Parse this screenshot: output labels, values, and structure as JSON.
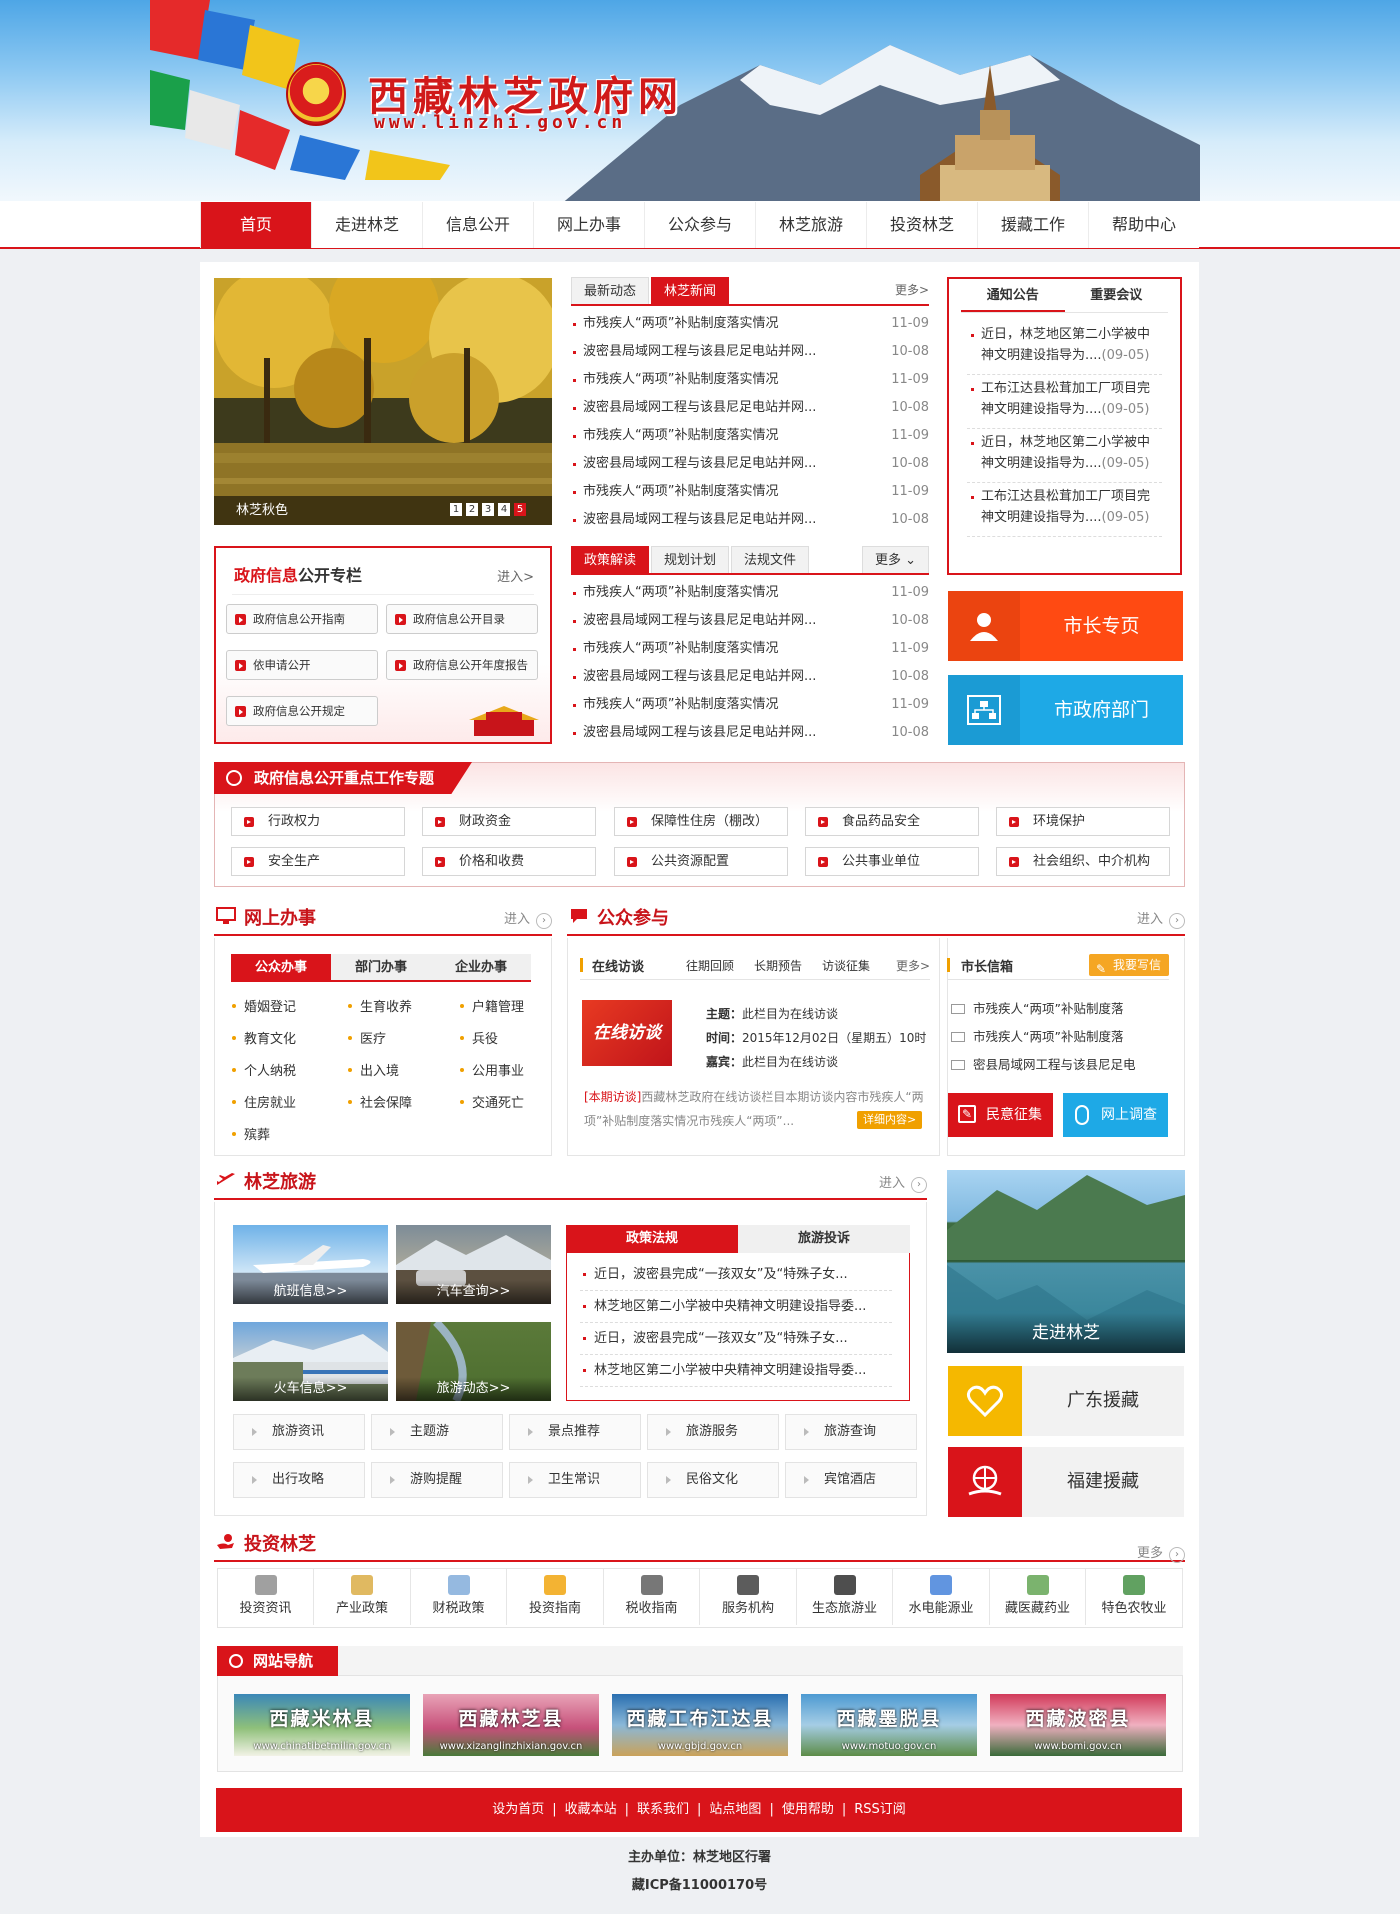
{
  "header": {
    "site_title": "西藏林芝政府网",
    "site_url": "www.linzhi.gov.cn"
  },
  "nav": [
    "首页",
    "走进林芝",
    "信息公开",
    "网上办事",
    "公众参与",
    "林芝旅游",
    "投资林芝",
    "援藏工作",
    "帮助中心"
  ],
  "slideshow": {
    "caption": "林芝秋色",
    "pages": [
      "1",
      "2",
      "3",
      "4",
      "5"
    ],
    "active_page": "5"
  },
  "news1": {
    "tabs": [
      "最新动态",
      "林芝新闻"
    ],
    "active": "林芝新闻",
    "more": "更多>",
    "items": [
      {
        "title": "市残疾人“两项”补贴制度落实情况",
        "date": "11-09"
      },
      {
        "title": "波密县局域网工程与该县尼足电站并网...",
        "date": "10-08"
      },
      {
        "title": "市残疾人“两项”补贴制度落实情况",
        "date": "11-09"
      },
      {
        "title": "波密县局域网工程与该县尼足电站并网...",
        "date": "10-08"
      },
      {
        "title": "市残疾人“两项”补贴制度落实情况",
        "date": "11-09"
      },
      {
        "title": "波密县局域网工程与该县尼足电站并网...",
        "date": "10-08"
      },
      {
        "title": "市残疾人“两项”补贴制度落实情况",
        "date": "11-09"
      },
      {
        "title": "波密县局域网工程与该县尼足电站并网...",
        "date": "10-08"
      }
    ]
  },
  "news2": {
    "tabs": [
      "政策解读",
      "规划计划",
      "法规文件"
    ],
    "active": "政策解读",
    "more": "更多",
    "items": [
      {
        "title": "市残疾人“两项”补贴制度落实情况",
        "date": "11-09"
      },
      {
        "title": "波密县局域网工程与该县尼足电站并网...",
        "date": "10-08"
      },
      {
        "title": "市残疾人“两项”补贴制度落实情况",
        "date": "11-09"
      },
      {
        "title": "波密县局域网工程与该县尼足电站并网...",
        "date": "10-08"
      },
      {
        "title": "市残疾人“两项”补贴制度落实情况",
        "date": "11-09"
      },
      {
        "title": "波密县局域网工程与该县尼足电站并网...",
        "date": "10-08"
      }
    ]
  },
  "notice": {
    "tabs": [
      "通知公告",
      "重要会议"
    ],
    "items": [
      {
        "title": "近日，林芝地区第二小学被中神文明建设指导为....",
        "date": "(09-05)"
      },
      {
        "title": "工布江达县松茸加工厂项目完神文明建设指导为....",
        "date": "(09-05)"
      },
      {
        "title": "近日，林芝地区第二小学被中神文明建设指导为....",
        "date": "(09-05)"
      },
      {
        "title": "工布江达县松茸加工厂项目完神文明建设指导为....",
        "date": "(09-05)"
      }
    ]
  },
  "bigbuttons": {
    "mayor": "市长专页",
    "depts": "市政府部门",
    "mayor_color": "#ff4a12",
    "depts_color": "#1ea9e6"
  },
  "govinfo": {
    "title_red": "政府信息",
    "title_black": "公开专栏",
    "enter": "进入>",
    "buttons": [
      "政府信息公开指南",
      "政府信息公开目录",
      "依申请公开",
      "政府信息公开年度报告",
      "政府信息公开规定"
    ]
  },
  "topics": {
    "title": "政府信息公开重点工作专题",
    "items": [
      "行政权力",
      "财政资金",
      "保障性住房（棚改）",
      "食品药品安全",
      "环境保护",
      "安全生产",
      "价格和收费",
      "公共资源配置",
      "公共事业单位",
      "社会组织、中介机构"
    ]
  },
  "online": {
    "title": "网上办事",
    "enter": "进入",
    "tabs": [
      "公众办事",
      "部门办事",
      "企业办事"
    ],
    "items": [
      "婚姻登记",
      "生育收养",
      "户籍管理",
      "教育文化",
      "医疗",
      "兵役",
      "个人纳税",
      "出入境",
      "公用事业",
      "住房就业",
      "社会保障",
      "交通死亡",
      "殡葬"
    ]
  },
  "public": {
    "title": "公众参与",
    "enter": "进入",
    "interview": {
      "title": "在线访谈",
      "tabs": [
        "往期回顾",
        "长期预告",
        "访谈征集"
      ],
      "more": "更多>",
      "logo": "在线访谈",
      "topic_label": "主题：",
      "topic": "此栏目为在线访谈",
      "time_label": "时间：",
      "time": "2015年12月02日（星期五）10时",
      "guest_label": "嘉宾：",
      "guest": "此栏目为在线访谈",
      "summary_tag": "[本期访谈]",
      "summary": "西藏林芝政府在线访谈栏目本期访谈内容市残疾人“两项”补贴制度落实情况市残疾人“两项”...",
      "detail": "详细内容>"
    },
    "mailbox": {
      "title": "市长信箱",
      "write": "我要写信",
      "items": [
        "市残疾人“两项”补贴制度落",
        "市残疾人“两项”补贴制度落",
        "密县局域网工程与该县尼足电"
      ],
      "survey1": "民意征集",
      "survey2": "网上调查"
    }
  },
  "tourism": {
    "title": "林芝旅游",
    "enter": "进入",
    "tiles": [
      "航班信息>>",
      "汽车查询>>",
      "火车信息>>",
      "旅游动态>>"
    ],
    "tabs": [
      "政策法规",
      "旅游投诉"
    ],
    "items": [
      "近日，波密县完成“一孩双女”及“特殊子女...",
      "林芝地区第二小学被中央精神文明建设指导委...",
      "近日，波密县完成“一孩双女”及“特殊子女...",
      "林芝地区第二小学被中央精神文明建设指导委..."
    ],
    "links": [
      "旅游资讯",
      "主题游",
      "景点推荐",
      "旅游服务",
      "旅游查询",
      "出行攻略",
      "游购提醒",
      "卫生常识",
      "民俗文化",
      "宾馆酒店"
    ]
  },
  "side": {
    "explore": "走进林芝",
    "guangdong": "广东援藏",
    "fujian": "福建援藏"
  },
  "invest": {
    "title": "投资林芝",
    "more": "更多",
    "items": [
      "投资资讯",
      "产业政策",
      "财税政策",
      "投资指南",
      "税收指南",
      "服务机构",
      "生态旅游业",
      "水电能源业",
      "藏医藏药业",
      "特色农牧业"
    ]
  },
  "sitenav": {
    "title": "网站导航",
    "banners": [
      {
        "name": "西藏米林县",
        "url": "www.chinatibetmilin.gov.cn"
      },
      {
        "name": "西藏林芝县",
        "url": "www.xizanglinzhixian.gov.cn"
      },
      {
        "name": "西藏工布江达县",
        "url": "www.gbjd.gov.cn"
      },
      {
        "name": "西藏墨脱县",
        "url": "www.motuo.gov.cn"
      },
      {
        "name": "西藏波密县",
        "url": "www.bomi.gov.cn"
      }
    ]
  },
  "footer": {
    "links": [
      "设为首页",
      "收藏本站",
      "联系我们",
      "站点地图",
      "使用帮助",
      "RSS订阅"
    ],
    "host": "主办单位：林芝地区行署",
    "icp": "藏ICP备11000170号"
  }
}
